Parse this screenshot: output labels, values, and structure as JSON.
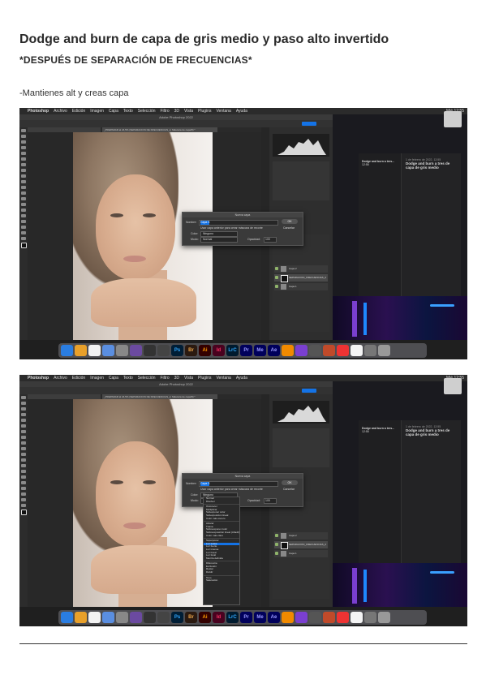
{
  "doc": {
    "title": "Dodge and burn de capa de gris medio y paso alto invertido",
    "subtitle": "*DESPUÉS DE SEPARACIÓN DE FRECUENCIAS*",
    "note": "-Mantienes alt y creas capa"
  },
  "menubar": {
    "items": [
      "Photoshop",
      "Archivo",
      "Edición",
      "Imagen",
      "Capa",
      "Texto",
      "Selección",
      "Filtro",
      "3D",
      "Vista",
      "Plugins",
      "Ventana",
      "Ayuda"
    ],
    "clock": "Mié 12:55"
  },
  "ps": {
    "window_title": "Adobe Photoshop 2022",
    "doc_tab": "_PREPARAR al 24,5% (SEPARACION DE FRECUENCIAS_2, Máscara de capa/8) *"
  },
  "notes": {
    "item_title": "Dodge and burn a tres...",
    "item_time": "12:55",
    "note_date": "1 de febrero de 2022, 12:55",
    "note_title": "Dodge and burn a tres de capa de gris medio"
  },
  "dialog1": {
    "title": "Nueva capa",
    "name_label": "Nombre:",
    "name_value": "Capa 3",
    "ok": "OK",
    "cancel": "Cancelar",
    "clip_label": "Usar capa anterior para crear máscara de recorte",
    "color_label": "Color:",
    "color_value": "Ninguno",
    "mode_label": "Modo:",
    "mode_value": "Normal",
    "opacity_label": "Opacidad:",
    "opacity_value": "100"
  },
  "dialog2": {
    "title": "Nueva capa",
    "name_label": "Nombre:",
    "name_value": "Capa 3",
    "ok": "OK",
    "cancel": "Cancelar",
    "clip_label": "Usar capa anterior para crear máscara de recorte",
    "color_label": "Color:",
    "color_value": "Ninguno",
    "mode_label": "Modo:",
    "mode_value": "Normal",
    "opacity_label": "Opacidad:",
    "opacity_value": "100"
  },
  "blend_modes": [
    "Normal",
    "Disolver",
    "Oscurecer",
    "Multiplicar",
    "Subexponer color",
    "Subexposición lineal",
    "Color más oscuro",
    "Aclarar",
    "Trama",
    "Sobreexponer color",
    "Sobreexposición lineal (Añadir)",
    "Color más claro",
    "Superponer",
    "Luz suave",
    "Luz fuerte",
    "Luz intensa",
    "Luz lineal",
    "Luz focal",
    "Mezcla definida",
    "Diferencia",
    "Exclusión",
    "Restar",
    "Dividir",
    "Tono",
    "Saturación"
  ],
  "blend_selected": "Luz suave",
  "layers": [
    "Capa 2",
    "SEPARACION_FRECUENCIAS_2",
    "Capa 1"
  ],
  "dock_apps": [
    "Ps",
    "Br",
    "Ai",
    "Id",
    "LrC",
    "Pr",
    "Me",
    "Ae"
  ]
}
